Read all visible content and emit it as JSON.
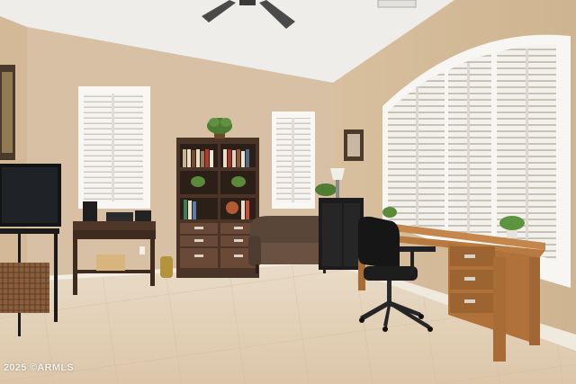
{
  "watermark": "2025 ©ARMLS",
  "colors": {
    "wall": "#d7c0a3",
    "wall_right": "#d2b896",
    "ceiling": "#f1f0ec",
    "floor": "#e6d4bc",
    "wood_dark": "#4a3427",
    "wood_desk": "#c0803f",
    "shutter": "#f4f2ee"
  }
}
